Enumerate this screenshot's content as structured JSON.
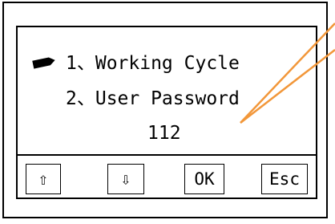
{
  "menu": {
    "item1": "1、Working Cycle",
    "item2": "2、User Password",
    "value": "112"
  },
  "keys": {
    "up": "⇧",
    "down": "⇩",
    "ok": "OK",
    "esc": "Esc"
  },
  "colors": {
    "leader_line": "#f2973a",
    "ink": "#000000"
  },
  "icons": {
    "cursor": "selection-cursor-icon",
    "up": "up-arrow-icon",
    "down": "down-arrow-icon"
  }
}
